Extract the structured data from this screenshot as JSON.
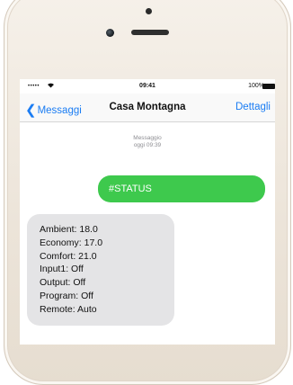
{
  "status_bar": {
    "signal": "•••••",
    "wifi_icon": "wifi-icon",
    "time": "09:41",
    "battery": "100%"
  },
  "nav": {
    "back_label": "Messaggi",
    "title": "Casa Montagna",
    "details_label": "Dettagli"
  },
  "thread": {
    "meta_label": "Messaggio",
    "meta_time": "oggi 09:39",
    "sent": {
      "text": "#STATUS",
      "color": "#3ec94d"
    },
    "received": {
      "lines": [
        "Ambient: 18.0",
        "Economy: 17.0",
        "Comfort: 21.0",
        "Input1: Off",
        "Output: Off",
        "Program: Off",
        "Remote: Auto"
      ],
      "color": "#e4e4e6"
    }
  },
  "accent": "#1a7cf3"
}
